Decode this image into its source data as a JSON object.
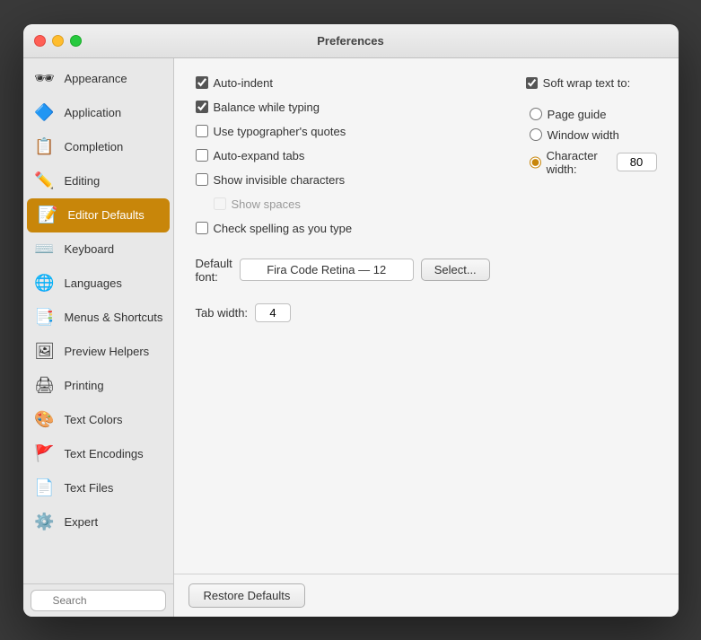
{
  "window": {
    "title": "Preferences"
  },
  "sidebar": {
    "items": [
      {
        "id": "appearance",
        "label": "Appearance",
        "icon": "🕶"
      },
      {
        "id": "application",
        "label": "Application",
        "icon": "🔷"
      },
      {
        "id": "completion",
        "label": "Completion",
        "icon": "📋"
      },
      {
        "id": "editing",
        "label": "Editing",
        "icon": "✏️"
      },
      {
        "id": "editor-defaults",
        "label": "Editor Defaults",
        "icon": "📝",
        "active": true
      },
      {
        "id": "keyboard",
        "label": "Keyboard",
        "icon": "⌨️"
      },
      {
        "id": "languages",
        "label": "Languages",
        "icon": "🌐"
      },
      {
        "id": "menus-shortcuts",
        "label": "Menus & Shortcuts",
        "icon": "📑"
      },
      {
        "id": "preview-helpers",
        "label": "Preview Helpers",
        "icon": "🖼"
      },
      {
        "id": "printing",
        "label": "Printing",
        "icon": "🖨"
      },
      {
        "id": "text-colors",
        "label": "Text Colors",
        "icon": "🎨"
      },
      {
        "id": "text-encodings",
        "label": "Text Encodings",
        "icon": "🚩"
      },
      {
        "id": "text-files",
        "label": "Text Files",
        "icon": "📄"
      },
      {
        "id": "expert",
        "label": "Expert",
        "icon": "⚙️"
      }
    ],
    "search_placeholder": "Search"
  },
  "main": {
    "checkboxes": {
      "auto_indent": {
        "label": "Auto-indent",
        "checked": true
      },
      "balance_while_typing": {
        "label": "Balance while typing",
        "checked": true
      },
      "typographers_quotes": {
        "label": "Use typographer's quotes",
        "checked": false
      },
      "auto_expand_tabs": {
        "label": "Auto-expand tabs",
        "checked": false
      },
      "show_invisible": {
        "label": "Show invisible characters",
        "checked": false
      },
      "show_spaces": {
        "label": "Show spaces",
        "checked": false
      },
      "check_spelling": {
        "label": "Check spelling as you type",
        "checked": false
      }
    },
    "soft_wrap": {
      "label": "Soft wrap text to:",
      "checked": true,
      "options": [
        {
          "id": "page-guide",
          "label": "Page guide",
          "selected": false
        },
        {
          "id": "window-width",
          "label": "Window width",
          "selected": false
        },
        {
          "id": "character-width",
          "label": "Character width:",
          "selected": true
        }
      ],
      "character_width_value": "80"
    },
    "font": {
      "label": "Default font:",
      "value": "Fira Code Retina — 12",
      "select_btn": "Select..."
    },
    "tab_width": {
      "label": "Tab width:",
      "value": "4"
    },
    "restore_btn": "Restore Defaults"
  }
}
